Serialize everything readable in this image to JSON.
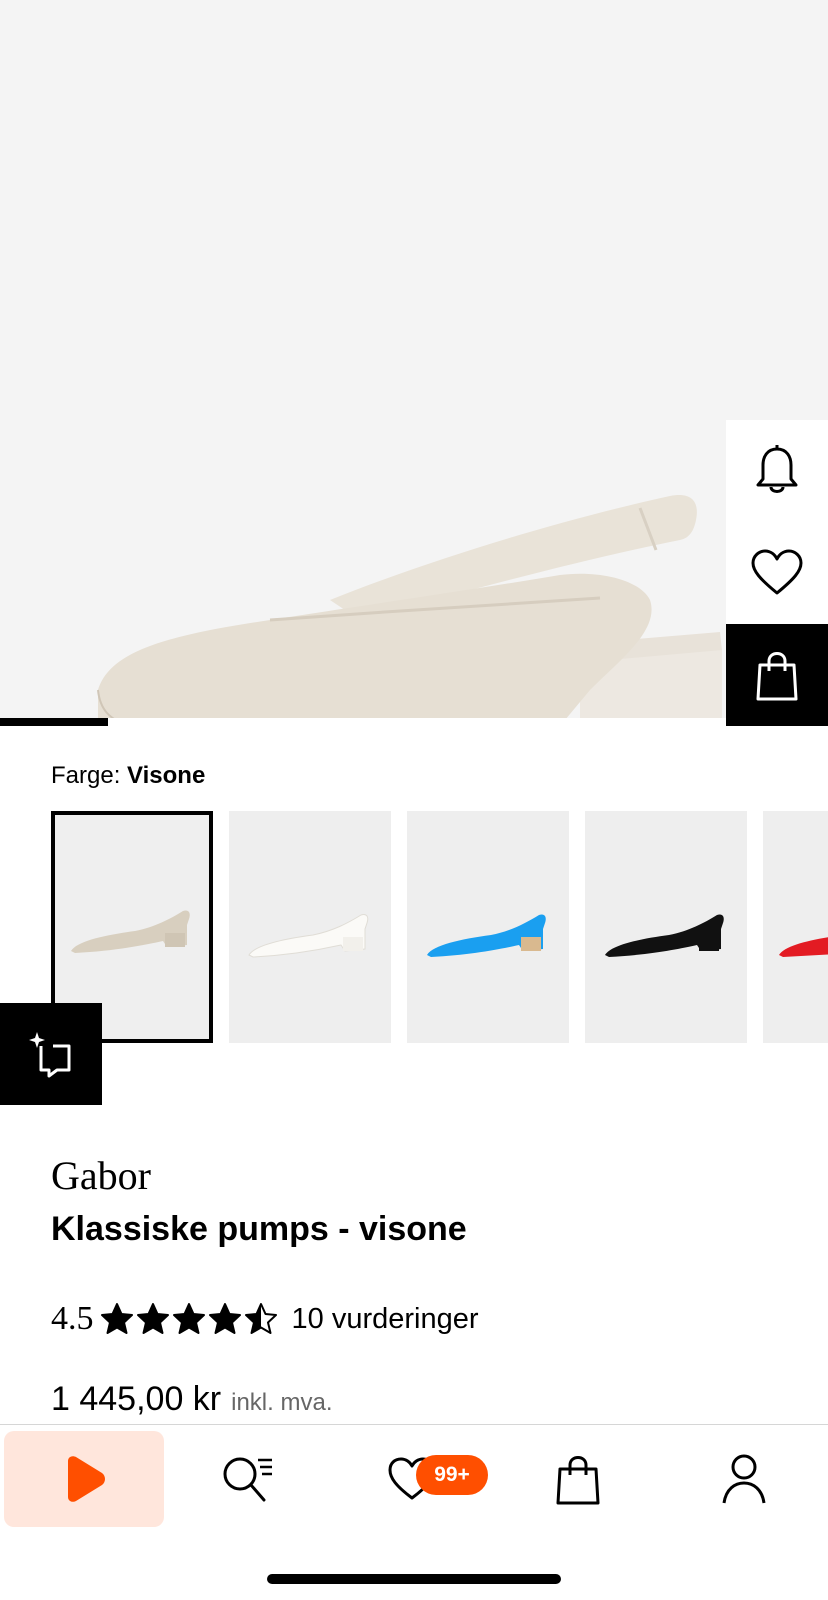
{
  "hero": {
    "image_alt": "",
    "carousel_progress": 0.13
  },
  "actions": {
    "notify_icon": "bell-icon",
    "wishlist_icon": "heart-icon",
    "bag_icon": "shopping-bag-icon"
  },
  "color": {
    "label": "Farge:",
    "selected": "Visone",
    "swatches": [
      {
        "color": "#e3dcd0",
        "selected": true
      },
      {
        "color": "#f3f1ec",
        "selected": false
      },
      {
        "color": "#1a9ff0",
        "selected": false
      },
      {
        "color": "#111111",
        "selected": false
      },
      {
        "color": "#e31b23",
        "selected": false
      }
    ]
  },
  "compare_icon": "sparkle-compare-icon",
  "product": {
    "brand": "Gabor",
    "title": "Klassiske pumps - visone",
    "rating": "4.5",
    "rating_value": 4.5,
    "rating_max": 5,
    "reviews": "10 vurderinger",
    "price": "1 445,00 kr",
    "vat": "inkl. mva."
  },
  "nav": {
    "items": [
      "play-icon",
      "search-list-icon",
      "heart-icon",
      "shopping-bag-icon",
      "user-icon"
    ],
    "wishlist_badge": "99+",
    "accent": "#ff4f00"
  }
}
